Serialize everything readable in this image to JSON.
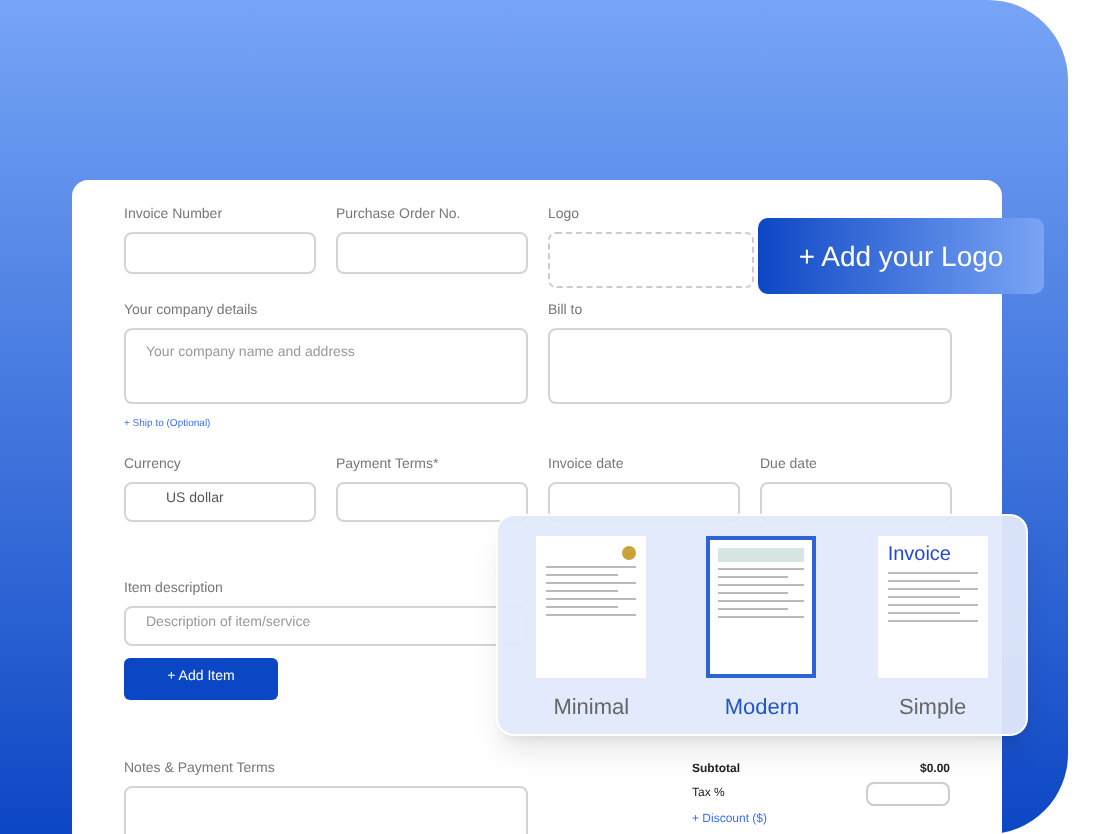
{
  "form": {
    "row1": [
      {
        "label": "Invoice Number"
      },
      {
        "label": "Purchase Order No."
      }
    ],
    "logo": {
      "label": "Logo"
    },
    "company": {
      "label": "Your company details",
      "placeholder": "Your company name and address"
    },
    "bill_to": {
      "label": "Bill to"
    },
    "ship_to_link": "+ Ship to (Optional)",
    "row3": [
      {
        "label": "Currency",
        "value": "US dollar"
      },
      {
        "label": "Payment Terms*"
      },
      {
        "label": "Invoice date"
      },
      {
        "label": "Due date"
      }
    ],
    "item": {
      "label": "Item description",
      "placeholder": "Description of item/service"
    },
    "add_item": "+ Add Item",
    "notes": {
      "label": "Notes & Payment Terms"
    },
    "totals": {
      "subtotal_label": "Subtotal",
      "subtotal_value": "$0.00",
      "tax_label": "Tax %",
      "discount_link": "+ Discount ($)"
    }
  },
  "add_logo_button": "+ Add your Logo",
  "templates": [
    {
      "name": "Minimal",
      "selected": false,
      "kind": "minimal"
    },
    {
      "name": "Modern",
      "selected": true,
      "kind": "modern"
    },
    {
      "name": "Simple",
      "selected": false,
      "kind": "simple",
      "heading": "Invoice"
    }
  ]
}
